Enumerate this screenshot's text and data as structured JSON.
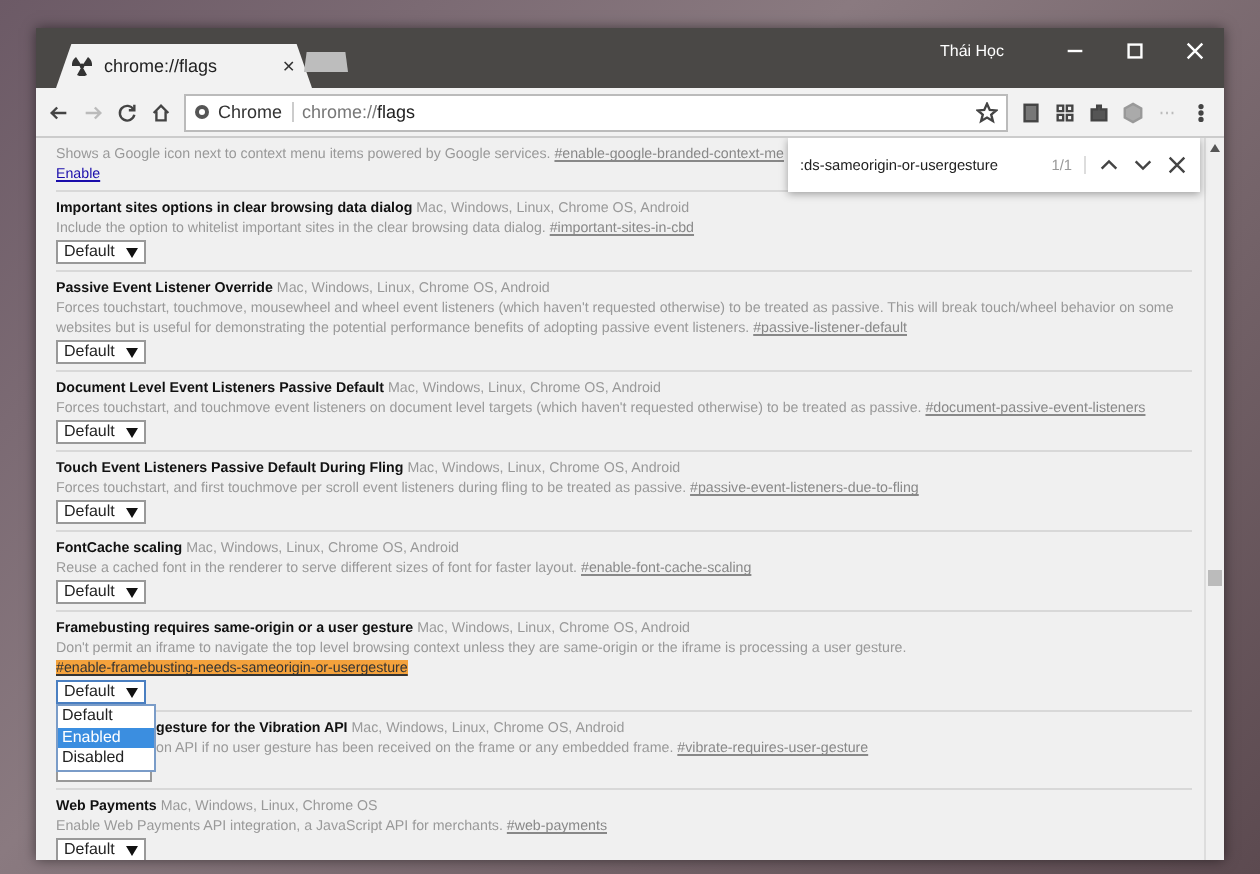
{
  "window": {
    "profile_name": "Thái Học"
  },
  "tabs": [
    {
      "title": "chrome://flags",
      "selected": true,
      "close": "✕"
    },
    {
      "selected": false
    }
  ],
  "address_bar": {
    "site_label": "Chrome",
    "url_prefix": "chrome://",
    "url_host": "flags"
  },
  "find_bar": {
    "query": ":ds-sameorigin-or-usergesture",
    "count": "1/1"
  },
  "flags": [
    {
      "kind": "partial",
      "description": "Shows a Google icon next to context menu items powered by Google services.",
      "link": "#enable-google-branded-context-me",
      "action": "Enable"
    },
    {
      "kind": "flag",
      "title": "Important sites options in clear browsing data dialog",
      "platforms": "Mac, Windows, Linux, Chrome OS, Android",
      "description": "Include the option to whitelist important sites in the clear browsing data dialog.",
      "link": "#important-sites-in-cbd",
      "highlighted": false,
      "select": "Default"
    },
    {
      "kind": "flag",
      "title": "Passive Event Listener Override",
      "platforms": "Mac, Windows, Linux, Chrome OS, Android",
      "description": "Forces touchstart, touchmove, mousewheel and wheel event listeners (which haven't requested otherwise) to be treated as passive. This will break touch/wheel behavior on some websites but is useful for demonstrating the potential performance benefits of adopting passive event listeners.",
      "link": "#passive-listener-default",
      "highlighted": false,
      "select": "Default"
    },
    {
      "kind": "flag",
      "title": "Document Level Event Listeners Passive Default",
      "platforms": "Mac, Windows, Linux, Chrome OS, Android",
      "description": "Forces touchstart, and touchmove event listeners on document level targets (which haven't requested otherwise) to be treated as passive.",
      "link": "#document-passive-event-listeners",
      "highlighted": false,
      "select": "Default"
    },
    {
      "kind": "flag",
      "title": "Touch Event Listeners Passive Default During Fling",
      "platforms": "Mac, Windows, Linux, Chrome OS, Android",
      "description": "Forces touchstart, and first touchmove per scroll event listeners during fling to be treated as passive.",
      "link": "#passive-event-listeners-due-to-fling",
      "highlighted": false,
      "select": "Default"
    },
    {
      "kind": "flag",
      "title": "FontCache scaling",
      "platforms": "Mac, Windows, Linux, Chrome OS, Android",
      "description": "Reuse a cached font in the renderer to serve different sizes of font for faster layout.",
      "link": "#enable-font-cache-scaling",
      "highlighted": false,
      "select": "Default"
    },
    {
      "kind": "flag",
      "title": "Framebusting requires same-origin or a user gesture",
      "platforms": "Mac, Windows, Linux, Chrome OS, Android",
      "description": "Don't permit an iframe to navigate the top level browsing context unless they are same-origin or the iframe is processing a user gesture.",
      "link": "#enable-framebusting-needs-sameorigin-or-usergesture",
      "highlighted": true,
      "select": "Default",
      "dropdown": [
        {
          "label": "Default",
          "selected": false
        },
        {
          "label": "Enabled",
          "selected": true
        },
        {
          "label": "Disabled",
          "selected": false
        }
      ]
    },
    {
      "kind": "covered",
      "title": "gesture for the Vibration API",
      "platforms": "Mac, Windows, Linux, Chrome OS, Android",
      "description": "on API if no user gesture has been received on the frame or any embedded frame.",
      "link": "#vibrate-requires-user-gesture"
    },
    {
      "kind": "flag",
      "title": "Web Payments",
      "platforms": "Mac, Windows, Linux, Chrome OS",
      "description": "Enable Web Payments API integration, a JavaScript API for merchants.",
      "link": "#web-payments",
      "highlighted": false,
      "select": "Default"
    }
  ]
}
